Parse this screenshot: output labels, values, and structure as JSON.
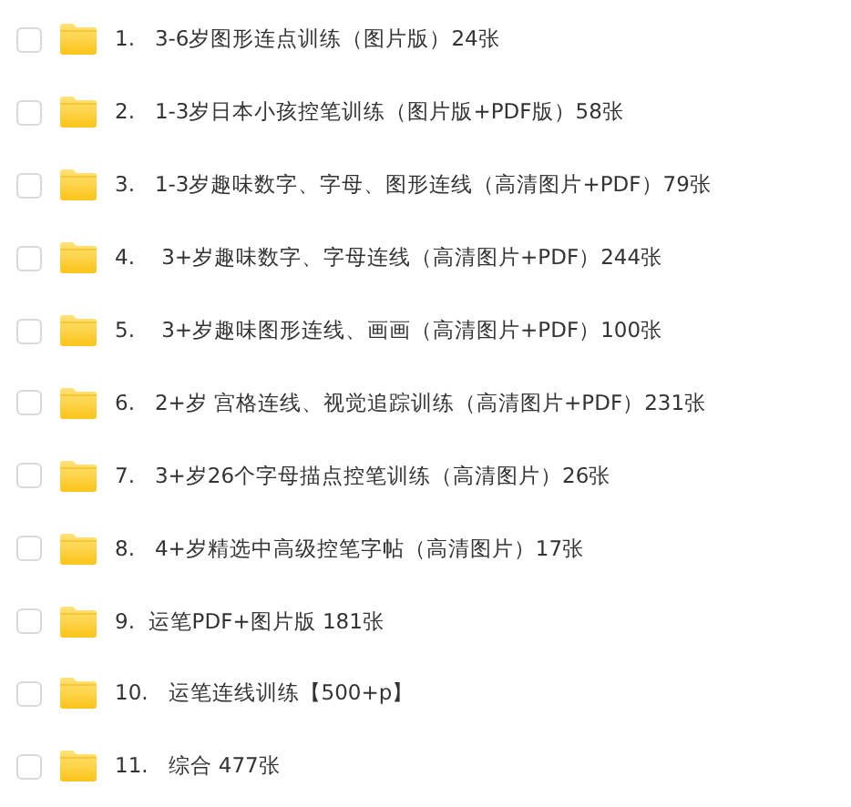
{
  "files": [
    {
      "name": "1.   3-6岁图形连点训练（图片版）24张",
      "checked": false
    },
    {
      "name": "2.   1-3岁日本小孩控笔训练（图片版+PDF版）58张",
      "checked": false
    },
    {
      "name": "3.   1-3岁趣味数字、字母、图形连线（高清图片+PDF）79张",
      "checked": false
    },
    {
      "name": "4.    3+岁趣味数字、字母连线（高清图片+PDF）244张",
      "checked": false
    },
    {
      "name": "5.    3+岁趣味图形连线、画画（高清图片+PDF）100张",
      "checked": false
    },
    {
      "name": "6.   2+岁 宫格连线、视觉追踪训练（高清图片+PDF）231张",
      "checked": false
    },
    {
      "name": "7.   3+岁26个字母描点控笔训练（高清图片）26张",
      "checked": false
    },
    {
      "name": "8.   4+岁精选中高级控笔字帖（高清图片）17张",
      "checked": false
    },
    {
      "name": "9.  运笔PDF+图片版 181张",
      "checked": false
    },
    {
      "name": "10.   运笔连线训练【500+p】",
      "checked": false
    },
    {
      "name": "11.   综合 477张",
      "checked": false
    }
  ]
}
